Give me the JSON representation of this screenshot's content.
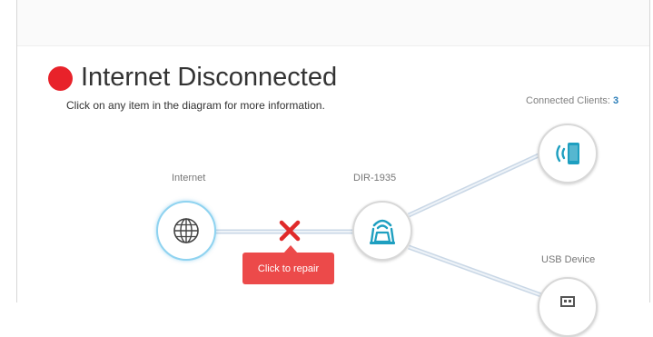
{
  "status": {
    "title": "Internet Disconnected",
    "color": "#e8222a",
    "instruction": "Click on any item in the diagram for more information."
  },
  "clients": {
    "label": "Connected Clients:",
    "count": "3"
  },
  "nodes": {
    "internet": {
      "label": "Internet",
      "icon": "globe-icon"
    },
    "router": {
      "label": "DIR-1935",
      "icon": "router-icon"
    },
    "client_device": {
      "icon": "tablet-wireless-icon"
    },
    "usb": {
      "label": "USB Device",
      "icon": "usb-icon"
    }
  },
  "repair_button": {
    "label": "Click to repair"
  },
  "colors": {
    "link": "#c9d7e6",
    "accent": "#1e9fc0",
    "error": "#ec4a4a",
    "count": "#2a7db8"
  }
}
